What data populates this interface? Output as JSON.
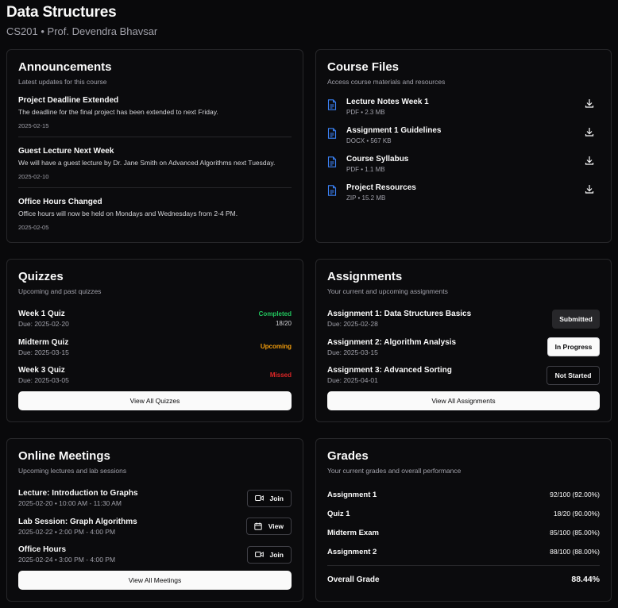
{
  "course": {
    "title": "Data Structures",
    "subtitle": "CS201 • Prof. Devendra Bhavsar"
  },
  "announcements": {
    "title": "Announcements",
    "description": "Latest updates for this course",
    "items": [
      {
        "title": "Project Deadline Extended",
        "text": "The deadline for the final project has been extended to next Friday.",
        "date": "2025-02-15"
      },
      {
        "title": "Guest Lecture Next Week",
        "text": "We will have a guest lecture by Dr. Jane Smith on Advanced Algorithms next Tuesday.",
        "date": "2025-02-10"
      },
      {
        "title": "Office Hours Changed",
        "text": "Office hours will now be held on Mondays and Wednesdays from 2-4 PM.",
        "date": "2025-02-05"
      }
    ]
  },
  "files": {
    "title": "Course Files",
    "description": "Access course materials and resources",
    "items": [
      {
        "name": "Lecture Notes Week 1",
        "meta": "PDF • 2.3 MB"
      },
      {
        "name": "Assignment 1 Guidelines",
        "meta": "DOCX • 567 KB"
      },
      {
        "name": "Course Syllabus",
        "meta": "PDF • 1.1 MB"
      },
      {
        "name": "Project Resources",
        "meta": "ZIP • 15.2 MB"
      }
    ]
  },
  "quizzes": {
    "title": "Quizzes",
    "description": "Upcoming and past quizzes",
    "items": [
      {
        "name": "Week 1 Quiz",
        "due": "Due: 2025-02-20",
        "status": "Completed",
        "score": "18/20"
      },
      {
        "name": "Midterm Quiz",
        "due": "Due: 2025-03-15",
        "status": "Upcoming",
        "score": ""
      },
      {
        "name": "Week 3 Quiz",
        "due": "Due: 2025-03-05",
        "status": "Missed",
        "score": ""
      }
    ],
    "button": "View All Quizzes",
    "status_colors": {
      "Completed": "#22c55e",
      "Upcoming": "#f59e0b",
      "Missed": "#dc2626"
    }
  },
  "assignments": {
    "title": "Assignments",
    "description": "Your current and upcoming assignments",
    "items": [
      {
        "name": "Assignment 1: Data Structures Basics",
        "due": "Due: 2025-02-28",
        "status": "Submitted"
      },
      {
        "name": "Assignment 2: Algorithm Analysis",
        "due": "Due: 2025-03-15",
        "status": "In Progress"
      },
      {
        "name": "Assignment 3: Advanced Sorting",
        "due": "Due: 2025-04-01",
        "status": "Not Started"
      }
    ],
    "button": "View All Assignments"
  },
  "meetings": {
    "title": "Online Meetings",
    "description": "Upcoming lectures and lab sessions",
    "items": [
      {
        "name": "Lecture: Introduction to Graphs",
        "time": "2025-02-20 • 10:00 AM - 11:30 AM",
        "action": "Join",
        "icon": "video-icon"
      },
      {
        "name": "Lab Session: Graph Algorithms",
        "time": "2025-02-22 • 2:00 PM - 4:00 PM",
        "action": "View",
        "icon": "calendar-icon"
      },
      {
        "name": "Office Hours",
        "time": "2025-02-24 • 3:00 PM - 4:00 PM",
        "action": "Join",
        "icon": "video-icon"
      }
    ],
    "button": "View All Meetings"
  },
  "grades": {
    "title": "Grades",
    "description": "Your current grades and overall performance",
    "items": [
      {
        "name": "Assignment 1",
        "value": "92/100 (92.00%)"
      },
      {
        "name": "Quiz 1",
        "value": "18/20 (90.00%)"
      },
      {
        "name": "Midterm Exam",
        "value": "85/100 (85.00%)"
      },
      {
        "name": "Assignment 2",
        "value": "88/100 (88.00%)"
      }
    ],
    "overall_label": "Overall Grade",
    "overall_value": "88.44%"
  },
  "colors": {
    "accent_blue": "#3b82f6",
    "background": "#09090b",
    "border": "#27272a"
  }
}
